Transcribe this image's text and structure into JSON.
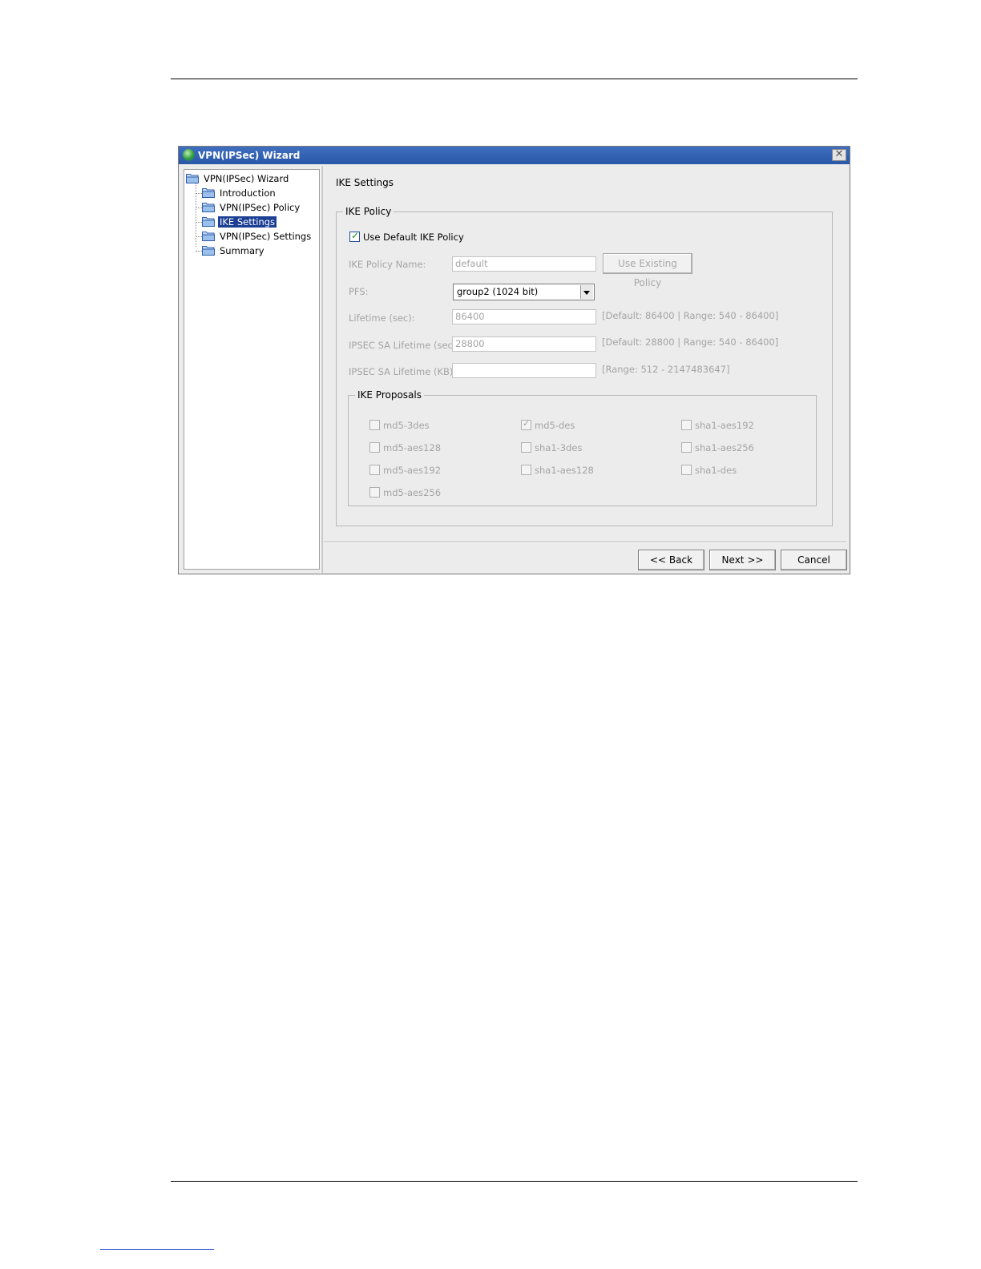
{
  "window": {
    "title": "VPN(IPSec) Wizard",
    "close_glyph": "✕"
  },
  "tree": {
    "root": "VPN(IPSec) Wizard",
    "items": [
      {
        "label": "Introduction"
      },
      {
        "label": "VPN(IPSec) Policy"
      },
      {
        "label": "IKE Settings",
        "selected": true
      },
      {
        "label": "VPN(IPSec) Settings"
      },
      {
        "label": "Summary"
      }
    ]
  },
  "page": {
    "title": "IKE Settings",
    "ike_policy": {
      "legend": "IKE Policy",
      "use_default_label": "Use Default IKE Policy",
      "use_default_checked": true,
      "policy_name_label": "IKE Policy Name:",
      "policy_name_value": "default",
      "use_existing_button": "Use Existing Policy",
      "pfs_label": "PFS:",
      "pfs_value": "group2 (1024 bit)",
      "lifetime_label": "Lifetime (sec):",
      "lifetime_value": "86400",
      "lifetime_hint": "[Default: 86400 | Range: 540 - 86400]",
      "sa_lifetime_label": "IPSEC SA Lifetime (sec):",
      "sa_lifetime_value": "28800",
      "sa_lifetime_hint": "[Default: 28800 | Range: 540 - 86400]",
      "sa_kb_label": "IPSEC SA Lifetime (KB):",
      "sa_kb_value": "",
      "sa_kb_hint": "[Range: 512 - 2147483647]"
    },
    "ike_proposals": {
      "legend": "IKE Proposals",
      "items": [
        {
          "label": "md5-3des",
          "checked": false
        },
        {
          "label": "md5-aes128",
          "checked": false
        },
        {
          "label": "md5-aes192",
          "checked": false
        },
        {
          "label": "md5-aes256",
          "checked": false
        },
        {
          "label": "md5-des",
          "checked": true
        },
        {
          "label": "sha1-3des",
          "checked": false
        },
        {
          "label": "sha1-aes128",
          "checked": false
        },
        {
          "label": "sha1-aes192",
          "checked": false
        },
        {
          "label": "sha1-aes256",
          "checked": false
        },
        {
          "label": "sha1-des",
          "checked": false
        }
      ]
    }
  },
  "buttons": {
    "back": "<< Back",
    "next": "Next >>",
    "cancel": "Cancel"
  },
  "colors": {
    "titlebar": "#2a57a8",
    "selection": "#1c3f94",
    "disabled_text": "#a4a4a4"
  }
}
